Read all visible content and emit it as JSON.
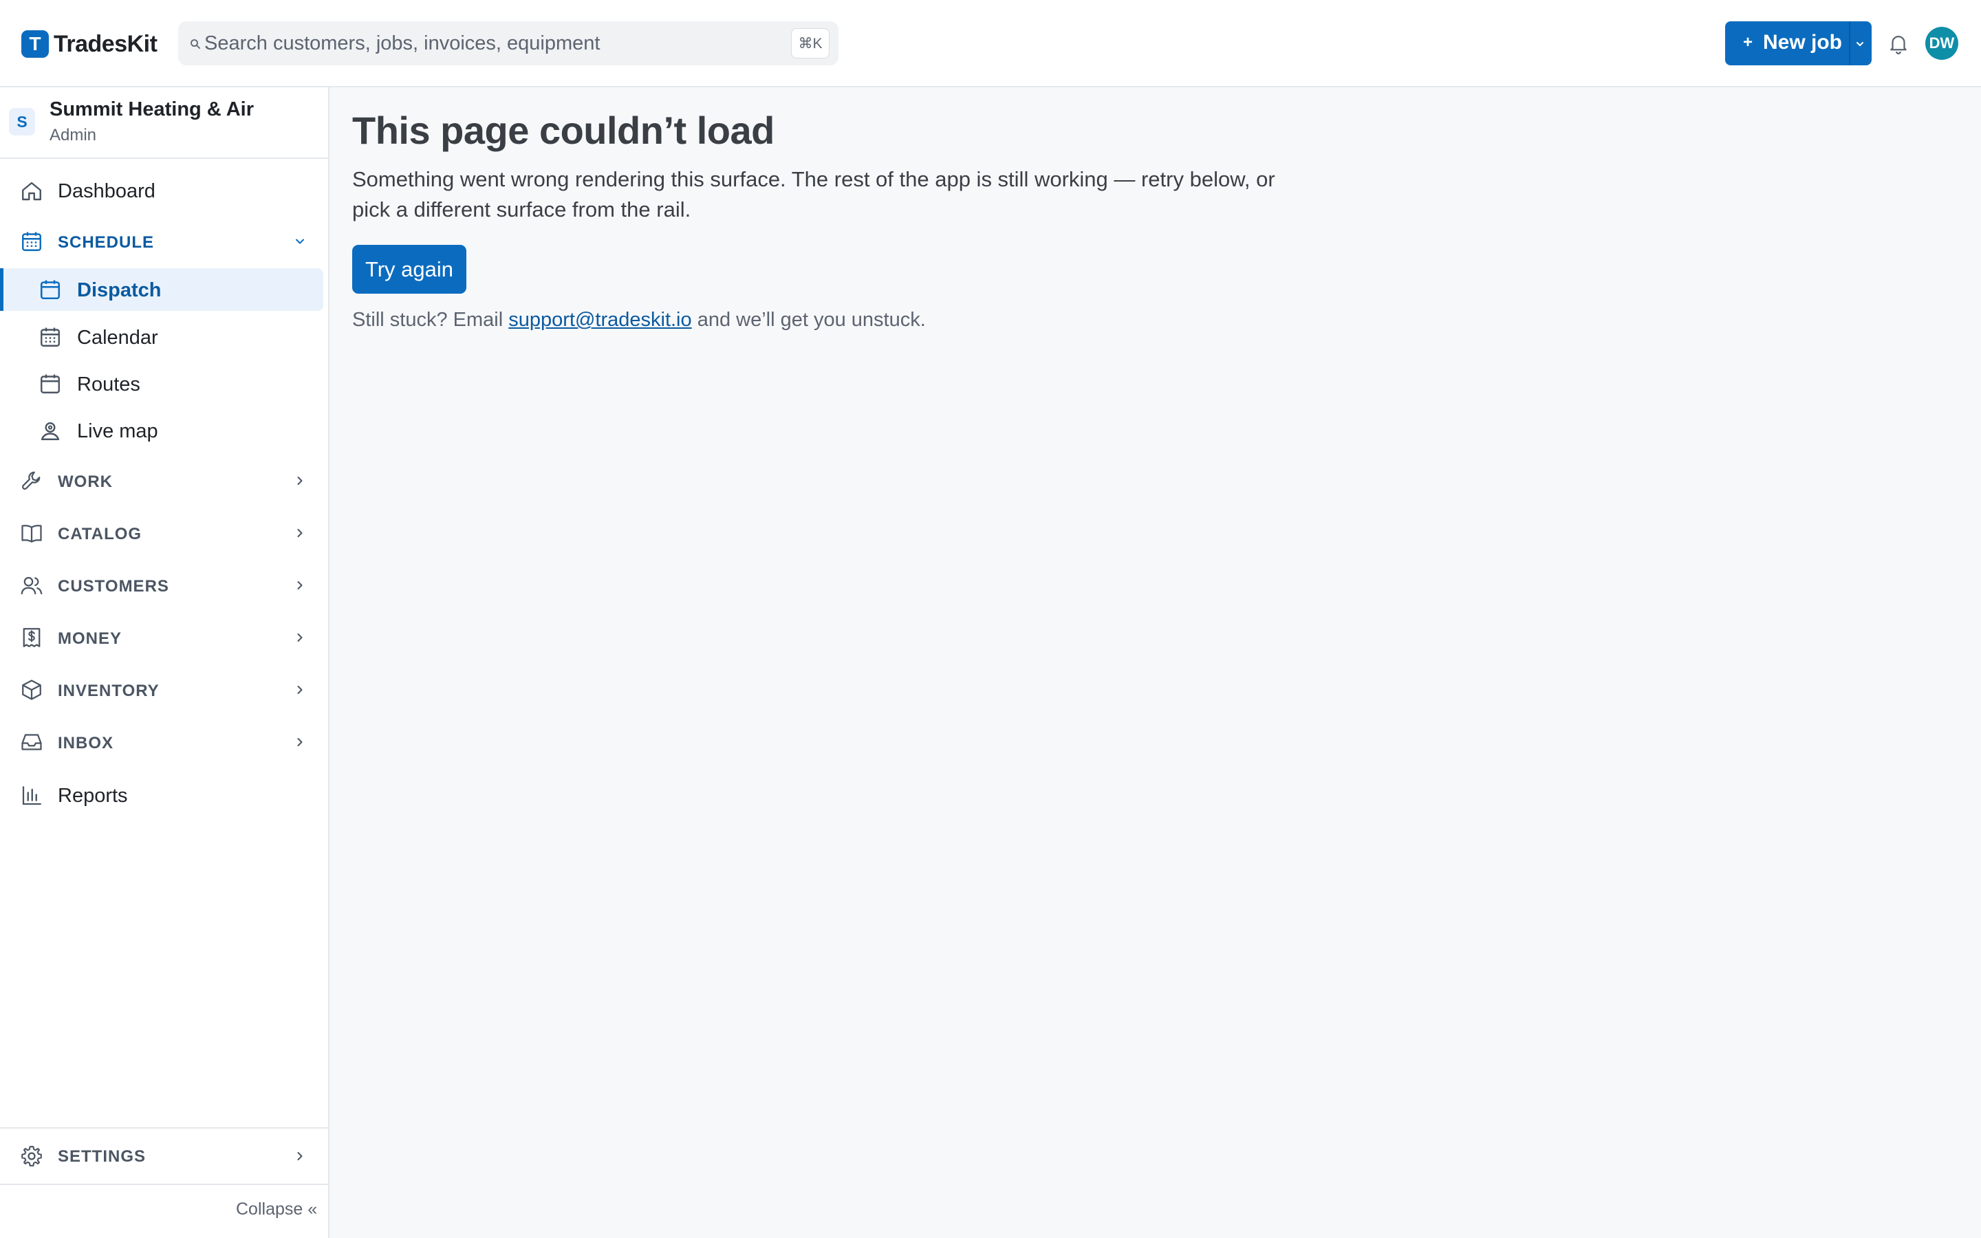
{
  "app": {
    "name": "TradesKit",
    "logo_letter": "T",
    "brand_color": "#0b6cbf"
  },
  "topbar": {
    "search_placeholder": "Search customers, jobs, invoices, equipment",
    "search_shortcut": "⌘K",
    "new_job_plus": "+",
    "new_job_label": "New job",
    "avatar_initials": "DW"
  },
  "org": {
    "badge": "S",
    "name": "Summit Heating & Air",
    "role": "Admin"
  },
  "sidebar": {
    "dashboard": "Dashboard",
    "schedule": {
      "label": "SCHEDULE",
      "expanded": true,
      "items": [
        {
          "label": "Dispatch",
          "active": true
        },
        {
          "label": "Calendar",
          "active": false
        },
        {
          "label": "Routes",
          "active": false
        },
        {
          "label": "Live map",
          "active": false
        }
      ]
    },
    "groups": [
      {
        "label": "WORK",
        "icon": "wrench-icon"
      },
      {
        "label": "CATALOG",
        "icon": "book-icon"
      },
      {
        "label": "CUSTOMERS",
        "icon": "users-icon"
      },
      {
        "label": "MONEY",
        "icon": "receipt-dollar-icon"
      },
      {
        "label": "INVENTORY",
        "icon": "box-icon"
      },
      {
        "label": "INBOX",
        "icon": "inbox-icon"
      }
    ],
    "reports": "Reports",
    "settings": "SETTINGS",
    "collapse": "Collapse «"
  },
  "main": {
    "title": "This page couldn’t load",
    "body": "Something went wrong rendering this surface. The rest of the app is still working — retry below, or pick a different surface from the rail.",
    "retry_label": "Try again",
    "help_prefix": "Still stuck? Email ",
    "help_email": "support@tradeskit.io",
    "help_suffix": " and we’ll get you unstuck."
  }
}
